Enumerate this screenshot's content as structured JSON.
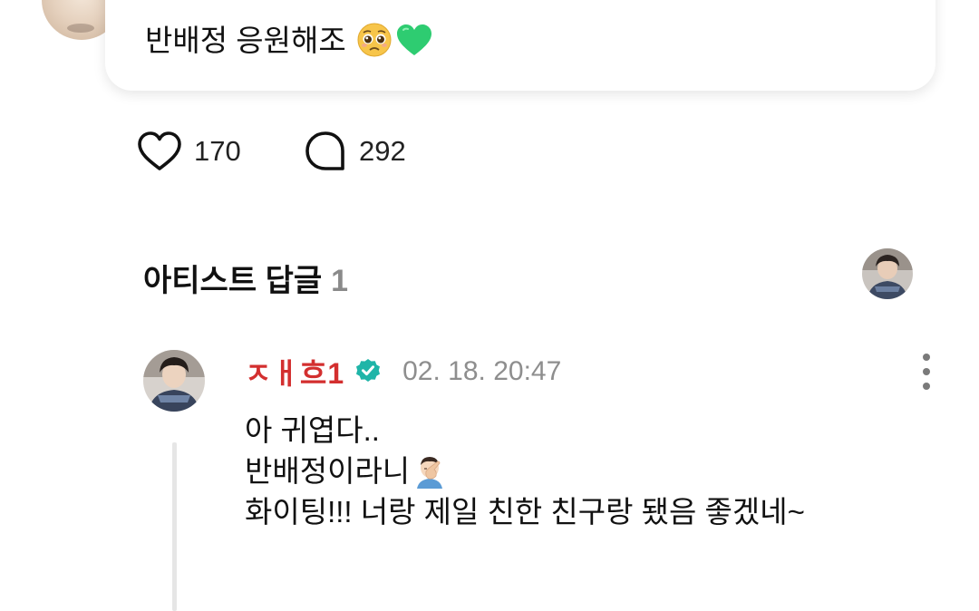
{
  "post": {
    "text": "반배정 응원해조",
    "emojis": [
      "pleading-face-emoji",
      "green-heart-emoji"
    ]
  },
  "actions": {
    "like_count": "170",
    "comment_count": "292",
    "like_icon": "heart-outline-icon",
    "comment_icon": "speech-bubble-icon"
  },
  "artist_replies": {
    "title": "아티스트 답글",
    "count": "1"
  },
  "reply": {
    "author": "ㅈㅐ흐1",
    "author_color": "#d32f2f",
    "verified_color": "#1fb5a8",
    "verified_icon": "verified-badge-icon",
    "date": "02. 18. 20:47",
    "lines": [
      "아 귀엽다..",
      "반배정이라니",
      "화이팅!!! 너랑 제일 친한 친구랑 됐음 좋겠네~"
    ],
    "line2_emoji": "facepalm-emoji",
    "more_icon": "more-vertical-icon"
  }
}
